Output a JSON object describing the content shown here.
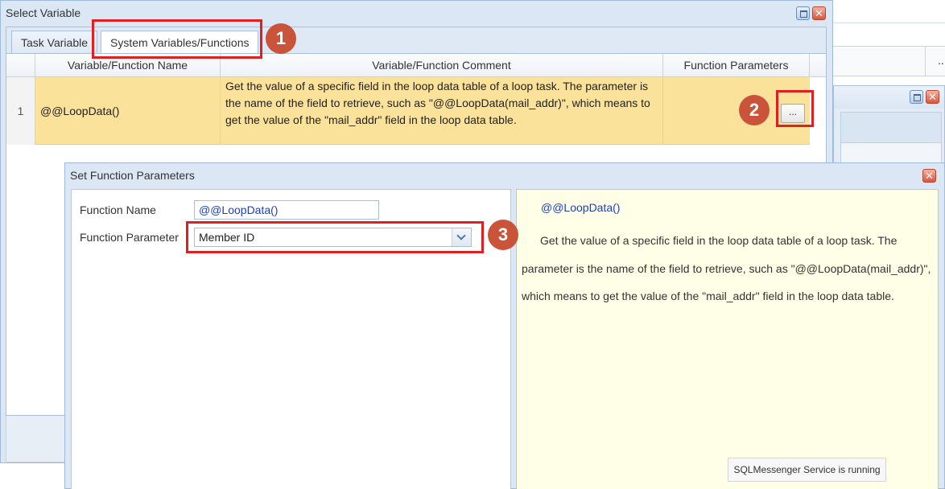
{
  "select_variable_window": {
    "title": "Select Variable",
    "tabs": [
      {
        "label": "Task Variable",
        "active": false
      },
      {
        "label": "System Variables/Functions",
        "active": true
      }
    ],
    "table": {
      "columns": [
        "Variable/Function Name",
        "Variable/Function Comment",
        "Function Parameters"
      ],
      "rows": [
        {
          "index": "1",
          "name": "@@LoopData()",
          "comment": "Get the value of a specific field in the loop data table of a loop task. The parameter is the name of the field to retrieve, such as \"@@LoopData(mail_addr)\", which means to get the value of the \"mail_addr\" field in the loop data table.",
          "params_button_label": "..."
        }
      ]
    }
  },
  "function_dialog": {
    "title": "Set Function Parameters",
    "function_name_label": "Function Name",
    "function_name_value": "@@LoopData()",
    "function_parameter_label": "Function Parameter",
    "function_parameter_value": "Member ID",
    "description_name": "@@LoopData()",
    "description_text": "Get the value of a specific field in the loop data table of a loop task. The parameter is the name of the field to retrieve, such as \"@@LoopData(mail_addr)\", which means to get the value of the \"mail_addr\" field in the loop data table."
  },
  "background": {
    "toolbar_more_label": "..."
  },
  "annotations": {
    "step1": "1",
    "step2": "2",
    "step3": "3",
    "highlight_color": "#e02020",
    "badge_color": "#c9543a"
  },
  "status_toast": "SQLMessenger Service is running",
  "colors": {
    "selected_row": "#fae29a",
    "window_bg": "#dbe7f4",
    "description_bg": "#ffffe7",
    "link_blue": "#1a3fc4"
  }
}
